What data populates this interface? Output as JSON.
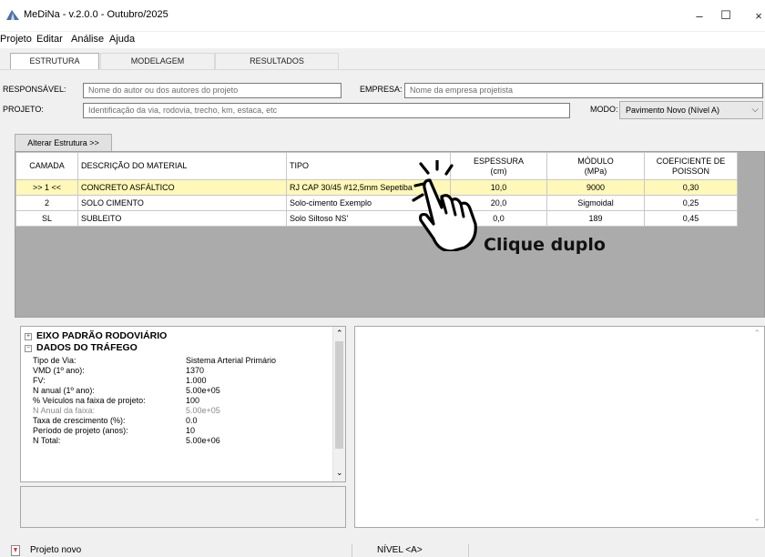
{
  "window": {
    "title": "MeDiNa - v.2.0.0 - Outubro/2025",
    "icon": "road-icon",
    "controls": {
      "minimize": "–",
      "maximize": "☐",
      "close": "×"
    }
  },
  "menu": [
    "Projeto",
    "Editar",
    "Análise",
    "Ajuda"
  ],
  "tabs": [
    {
      "label": "ESTRUTURA",
      "active": true
    },
    {
      "label": "MODELAGEM",
      "active": false
    },
    {
      "label": "RESULTADOS",
      "active": false
    }
  ],
  "form": {
    "responsavel_label": "RESPONSÁVEL:",
    "responsavel_value": "Nome do autor ou dos autores do projeto",
    "empresa_label": "EMPRESA:",
    "empresa_value": "Nome da empresa projetista",
    "projeto_label": "PROJETO:",
    "projeto_value": "Identificação da via, rodovia, trecho, km, estaca, etc",
    "modo_label": "MODO:",
    "modo_value": "Pavimento Novo (Nível A)"
  },
  "alter_button": "Alterar Estrutura >>",
  "layers_table": {
    "headers": [
      "CAMADA",
      "DESCRIÇÃO DO MATERIAL",
      "TIPO",
      "ESPESSURA\n(cm)",
      "MÓDULO\n(MPa)",
      "COEFICIENTE DE\nPOISSON"
    ],
    "rows": [
      [
        ">> 1 <<",
        "CONCRETO ASFÁLTICO",
        "RJ CAP 30/45 #12,5mm Sepetiba",
        "10,0",
        "9000",
        "0,30"
      ],
      [
        "2",
        "SOLO CIMENTO",
        "Solo-cimento Exemplo",
        "20,0",
        "Sigmoidal",
        "0,25"
      ],
      [
        "SL",
        "SUBLEITO",
        "Solo Siltoso NS'",
        "0,0",
        "189",
        "0,45"
      ]
    ],
    "selected_row": 0
  },
  "annotation": "Clique duplo",
  "properties": {
    "categories": [
      {
        "toggle": "+",
        "label": "EIXO PADRÃO RODOVIÁRIO"
      },
      {
        "toggle": "−",
        "label": "DADOS DO TRÁFEGO"
      }
    ],
    "rows": [
      {
        "key": "Tipo de Via:",
        "value": "Sistema Arterial Primário",
        "dim": false
      },
      {
        "key": "VMD (1º ano):",
        "value": "1370",
        "dim": false
      },
      {
        "key": "FV:",
        "value": "1.000",
        "dim": false
      },
      {
        "key": "N anual (1º ano):",
        "value": "5.00e+05",
        "dim": false
      },
      {
        "key": "% Veículos na faixa de projeto:",
        "value": "100",
        "dim": false
      },
      {
        "key": "N Anual da faixa:",
        "value": "5.00e+05",
        "dim": true
      },
      {
        "key": "Taxa de crescimento (%):",
        "value": "0.0",
        "dim": false
      },
      {
        "key": "Período de projeto (anos):",
        "value": "10",
        "dim": false
      },
      {
        "key": "N Total:",
        "value": "5.00e+06",
        "dim": false
      }
    ]
  },
  "status": {
    "left": "Projeto novo",
    "right": "NÍVEL <A>"
  }
}
